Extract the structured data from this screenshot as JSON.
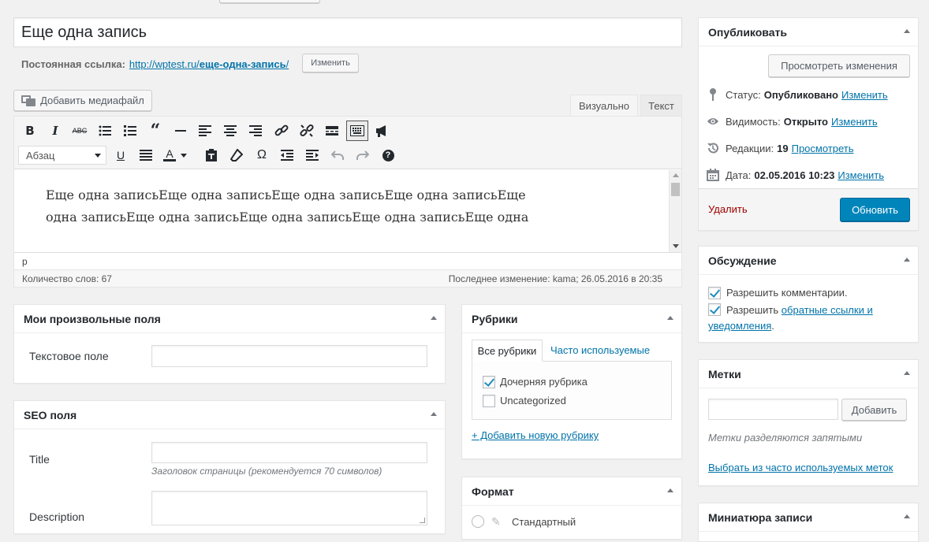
{
  "post": {
    "title": "Еще одна запись",
    "permalink_label": "Постоянная ссылка:",
    "permalink_base": "http://wptest.ru/",
    "permalink_slug": "еще-одна-запись",
    "permalink_end": "/",
    "permalink_edit": "Изменить"
  },
  "editor": {
    "add_media": "Добавить медиафайл",
    "tab_visual": "Визуально",
    "tab_text": "Текст",
    "format_select": "Абзац",
    "content": "Еще одна записьЕще одна записьЕще одна записьЕще одна записьЕще одна записьЕще одна записьЕще одна записьЕще одна записьЕще одна",
    "path": "p",
    "word_count": "Количество слов: 67",
    "last_edit": "Последнее изменение: kama; 26.05.2016 в 20:35"
  },
  "custom_fields": {
    "title": "Мои произвольные поля",
    "text_label": "Текстовое поле"
  },
  "seo": {
    "title": "SEO поля",
    "title_label": "Title",
    "title_hint": "Заголовок страницы (рекомендуется 70 символов)",
    "desc_label": "Description"
  },
  "categories": {
    "title": "Рубрики",
    "tab_all": "Все рубрики",
    "tab_popular": "Часто используемые",
    "items": [
      {
        "label": "Дочерняя рубрика",
        "checked": true
      },
      {
        "label": "Uncategorized",
        "checked": false
      }
    ],
    "add_link": "+ Добавить новую рубрику"
  },
  "format": {
    "title": "Формат",
    "option_standard": "Стандартный"
  },
  "publish": {
    "title": "Опубликовать",
    "preview": "Просмотреть изменения",
    "status_label": "Статус:",
    "status_value": "Опубликовано",
    "status_edit": "Изменить",
    "visibility_label": "Видимость:",
    "visibility_value": "Открыто",
    "visibility_edit": "Изменить",
    "revisions_label": "Редакции:",
    "revisions_value": "19",
    "revisions_link": "Просмотреть",
    "date_label": "Дата:",
    "date_value": "02.05.2016 10:23",
    "date_edit": "Изменить",
    "delete": "Удалить",
    "update": "Обновить"
  },
  "discussion": {
    "title": "Обсуждение",
    "allow_comments": "Разрешить комментарии.",
    "allow_pings_prefix": "Разрешить",
    "allow_pings_link": "обратные ссылки и уведомления",
    "allow_pings_suffix": "."
  },
  "tags": {
    "title": "Метки",
    "add": "Добавить",
    "hint": "Метки разделяются запятыми",
    "choose": "Выбрать из часто используемых меток"
  },
  "thumbnail": {
    "title": "Миниатюра записи"
  },
  "colors": {
    "link": "#0073aa",
    "primary": "#0085ba",
    "delete": "#a00000",
    "check": "#1e8cbe"
  }
}
